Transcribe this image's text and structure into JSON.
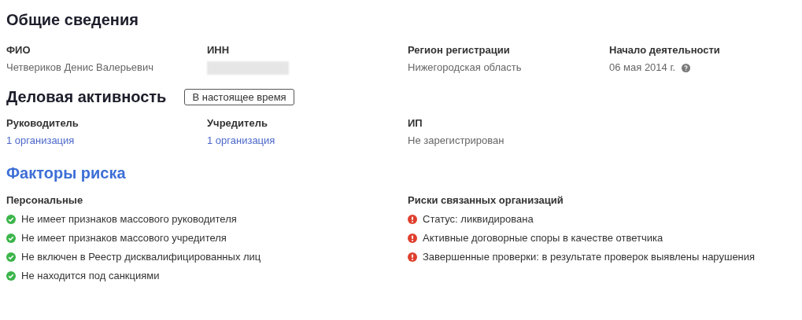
{
  "general": {
    "title": "Общие сведения",
    "fields": [
      {
        "label": "ФИО",
        "value": "Четвериков Денис Валерьевич"
      },
      {
        "label": "ИНН",
        "redacted": true
      },
      {
        "label": "Регион регистрации",
        "value": "Нижегородская область"
      },
      {
        "label": "Начало деятельности",
        "value": "06 мая 2014 г.",
        "help": true
      }
    ]
  },
  "activity": {
    "title": "Деловая активность",
    "period_button": "В настоящее время",
    "fields": [
      {
        "label": "Руководитель",
        "value": "1 организация",
        "link": true
      },
      {
        "label": "Учредитель",
        "value": "1 организация",
        "link": true
      },
      {
        "label": "ИП",
        "value": "Не зарегистрирован",
        "link": false
      }
    ]
  },
  "risks": {
    "title": "Факторы риска",
    "groups": [
      {
        "title": "Персональные",
        "items": [
          {
            "kind": "ok",
            "text": "Не имеет признаков массового руководителя"
          },
          {
            "kind": "ok",
            "text": "Не имеет признаков массового учредителя"
          },
          {
            "kind": "ok",
            "text": "Не включен в Реестр дисквалифицированных лиц"
          },
          {
            "kind": "ok",
            "text": "Не находится под санкциями"
          }
        ]
      },
      {
        "title": "Риски связанных организаций",
        "items": [
          {
            "kind": "warning",
            "text": "Статус: ликвидирована"
          },
          {
            "kind": "warning",
            "text": "Активные договорные споры в качестве ответчика"
          },
          {
            "kind": "warning",
            "text": "Завершенные проверки: в результате проверок выявлены нарушения"
          }
        ]
      }
    ]
  }
}
